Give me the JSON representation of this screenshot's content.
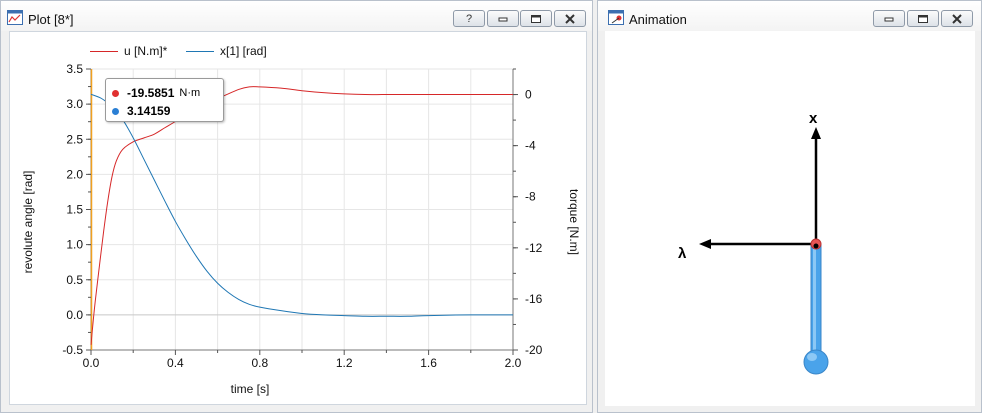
{
  "plot_window": {
    "title": "Plot [8*]",
    "buttons": {
      "help": "?",
      "minimize": "—",
      "maximize": "▭",
      "close": "✕"
    }
  },
  "animation_window": {
    "title": "Animation",
    "buttons": {
      "minimize": "—",
      "maximize": "▭",
      "close": "✕"
    }
  },
  "legend": {
    "u_label": "u [N.m]*",
    "x_label": "x[1] [rad]"
  },
  "tooltip": {
    "u_value": "-19.5851",
    "u_unit": "N·m",
    "x_value": "3.14159"
  },
  "colors": {
    "u_series": "#d62728",
    "x_series": "#1f77b4",
    "tip_red": "#e03030",
    "tip_blue": "#2a7fd4",
    "pendulum": "#4aa3ea",
    "joint": "#e85555"
  },
  "icons": [
    "plot-window-icon",
    "animation-window-icon",
    "help-icon",
    "minimize-icon",
    "maximize-icon",
    "close-icon"
  ],
  "chart_data": {
    "type": "line",
    "xlabel": "time [s]",
    "ylabel": "revolute angle [rad]",
    "y2label": "torque [N.m]",
    "xlim": [
      0,
      2.0
    ],
    "ylim": [
      -0.5,
      3.5
    ],
    "y2lim": [
      -20,
      2
    ],
    "xticks": [
      "0.0",
      "0.4",
      "0.8",
      "1.2",
      "1.6",
      "2.0"
    ],
    "yticks": [
      "-0.5",
      "0.0",
      "0.5",
      "1.0",
      "1.5",
      "2.0",
      "2.5",
      "3.0",
      "3.5"
    ],
    "y2ticks": [
      "0",
      "-4",
      "-8",
      "-12",
      "-16",
      "-20"
    ],
    "grid": true,
    "legend_position": "top",
    "series": [
      {
        "name": "u [N.m]*",
        "axis": "right",
        "x": [
          0,
          0.01,
          0.02,
          0.04,
          0.06,
          0.08,
          0.1,
          0.12,
          0.15,
          0.2,
          0.25,
          0.3,
          0.35,
          0.4,
          0.45,
          0.5,
          0.55,
          0.6,
          0.7,
          0.75,
          0.8,
          0.9,
          1.0,
          1.1,
          1.2,
          1.3,
          1.4,
          1.6,
          1.8,
          2.0
        ],
        "y": [
          -19.6,
          -17.8,
          -16.2,
          -13.4,
          -10.7,
          -8.3,
          -6.4,
          -5.2,
          -4.3,
          -3.7,
          -3.4,
          -3.1,
          -2.6,
          -2.1,
          -1.5,
          -0.9,
          -0.5,
          -0.3,
          0.4,
          0.6,
          0.6,
          0.5,
          0.3,
          0.15,
          0.05,
          0.0,
          0.0,
          0.0,
          0.0,
          0.0
        ]
      },
      {
        "name": "x[1] [rad]",
        "axis": "left",
        "x": [
          0,
          0.05,
          0.1,
          0.15,
          0.2,
          0.25,
          0.3,
          0.35,
          0.4,
          0.45,
          0.5,
          0.55,
          0.6,
          0.65,
          0.7,
          0.75,
          0.8,
          0.9,
          1.0,
          1.1,
          1.2,
          1.3,
          1.4,
          1.5,
          1.6,
          1.8,
          2.0
        ],
        "y": [
          3.14,
          3.08,
          2.96,
          2.78,
          2.52,
          2.22,
          1.92,
          1.62,
          1.33,
          1.07,
          0.83,
          0.62,
          0.45,
          0.32,
          0.22,
          0.15,
          0.11,
          0.06,
          0.02,
          0.0,
          -0.01,
          -0.02,
          -0.02,
          -0.02,
          -0.01,
          0.0,
          0.0
        ]
      }
    ]
  },
  "animation_labels": {
    "y_axis_label": "x",
    "x_axis_label": "λ"
  }
}
